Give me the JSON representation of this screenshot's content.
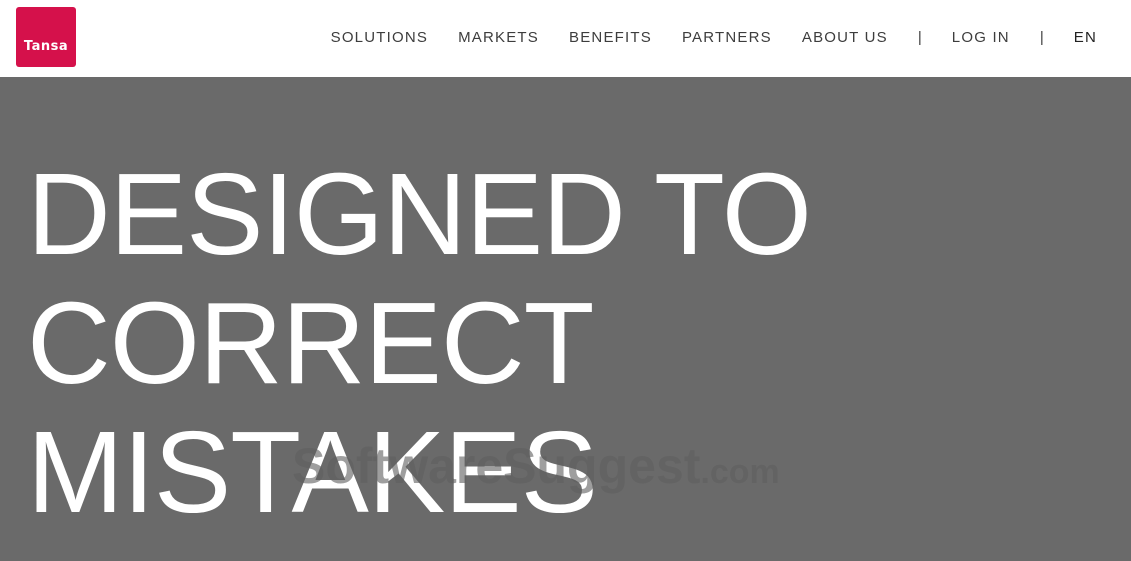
{
  "brand": {
    "logo_text": "Tansa",
    "logo_color": "#d5114b"
  },
  "nav": {
    "items": [
      {
        "label": "SOLUTIONS"
      },
      {
        "label": "MARKETS"
      },
      {
        "label": "BENEFITS"
      },
      {
        "label": "PARTNERS"
      },
      {
        "label": "ABOUT US"
      }
    ],
    "separator": "|",
    "login_label": "LOG IN",
    "language_label": "EN"
  },
  "hero": {
    "background_color": "#6a6a6a",
    "title_lines": [
      "DESIGNED TO",
      "CORRECT",
      "MISTAKES"
    ]
  },
  "watermark": {
    "text": "SoftwareSuggest",
    "suffix": ".com"
  }
}
